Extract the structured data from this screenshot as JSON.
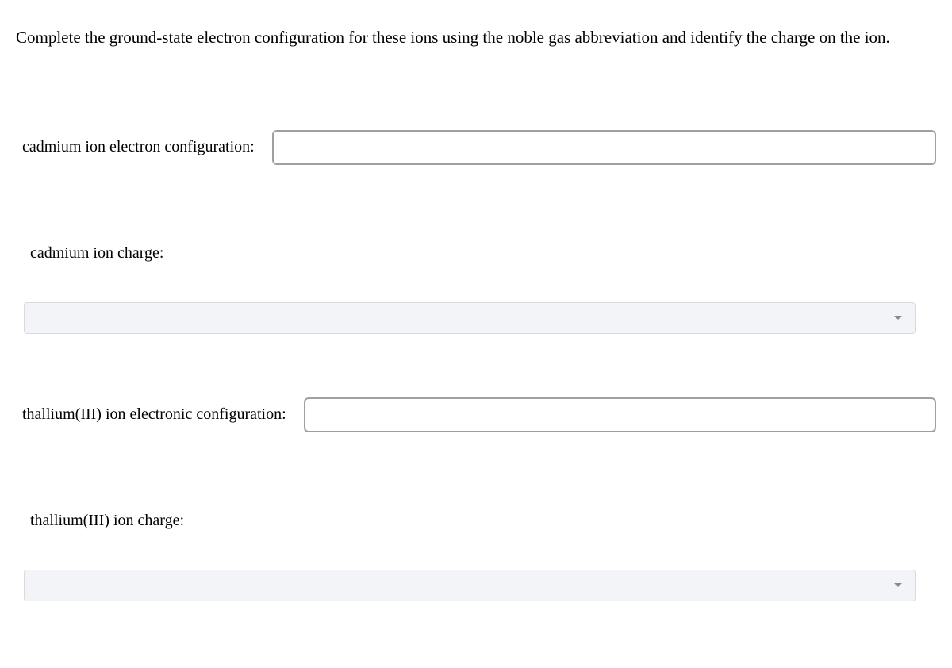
{
  "question": "Complete the ground-state electron configuration for these ions using the noble gas abbreviation and identify the charge on the ion.",
  "items": [
    {
      "config_label": "cadmium ion electron configuration:",
      "config_value": "",
      "charge_label": "cadmium ion charge:",
      "charge_value": ""
    },
    {
      "config_label": "thallium(III) ion electronic configuration:",
      "config_value": "",
      "charge_label": "thallium(III) ion charge:",
      "charge_value": ""
    }
  ]
}
